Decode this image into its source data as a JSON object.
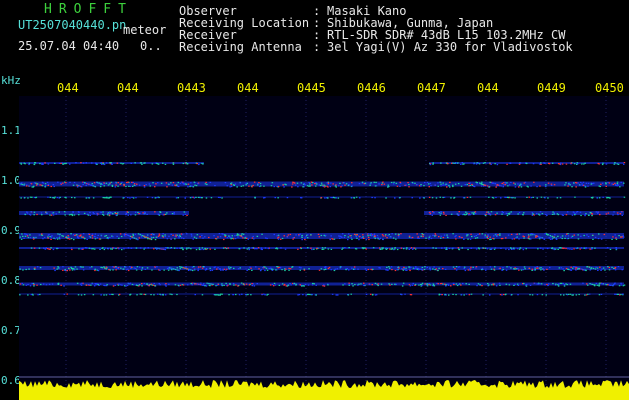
{
  "header": {
    "app_title": "HROFFT",
    "file_name": "UT2507040440.pn",
    "meteor_label": "meteor",
    "datetime": "25.07.04 04:40",
    "counter": "0..",
    "fields": [
      {
        "key": "Observer",
        "sep": ":",
        "value": "Masaki Kano"
      },
      {
        "key": "Receiving Location",
        "sep": ":",
        "value": "Shibukawa, Gunma, Japan"
      },
      {
        "key": "Receiver",
        "sep": ":",
        "value": "RTL-SDR SDR# 43dB L15 103.2MHz CW"
      },
      {
        "key": "Receiving Antenna",
        "sep": ":",
        "value": "3el Yagi(V) Az 330 for Vladivostok"
      }
    ]
  },
  "axes": {
    "freq_unit": "kHz",
    "time_ticks": [
      "044",
      "044",
      "0443",
      "044",
      "0445",
      "0446",
      "0447",
      "044",
      "0449",
      "0450"
    ],
    "freq_ticks": [
      "1.1",
      "1.0",
      "0.9",
      "0.8",
      "0.7",
      "0.6"
    ]
  },
  "colors": {
    "background": "#000000",
    "plot_background": "#000014",
    "tick_label": "#f0f000",
    "axis_label": "#56e0d8",
    "title": "#3dd13d",
    "signal_low": "#1e3cff",
    "signal_mid": "#19d0a0",
    "signal_high": "#ff3030",
    "noise_floor": "#f0f000"
  }
}
